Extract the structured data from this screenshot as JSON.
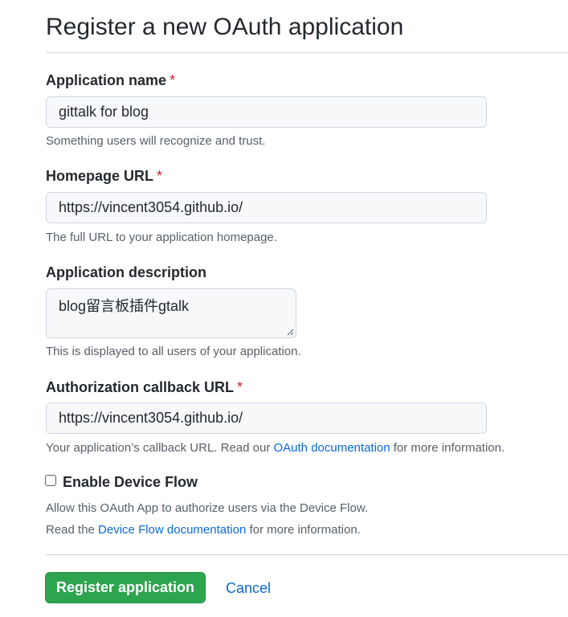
{
  "page": {
    "title": "Register a new OAuth application"
  },
  "form": {
    "app_name": {
      "label": "Application name",
      "required_mark": "*",
      "value": "gittalk for blog",
      "hint": "Something users will recognize and trust."
    },
    "homepage_url": {
      "label": "Homepage URL",
      "required_mark": "*",
      "value": "https://vincent3054.github.io/",
      "hint": "The full URL to your application homepage."
    },
    "description": {
      "label": "Application description",
      "value": "blog留言板插件gtalk",
      "hint": "This is displayed to all users of your application."
    },
    "callback_url": {
      "label": "Authorization callback URL",
      "required_mark": "*",
      "value": "https://vincent3054.github.io/",
      "hint_before": "Your application’s callback URL. Read our ",
      "hint_link": "OAuth documentation",
      "hint_after": " for more information."
    },
    "device_flow": {
      "label": "Enable Device Flow",
      "checked": false,
      "hint_line1": "Allow this OAuth App to authorize users via the Device Flow.",
      "hint_line2_before": "Read the ",
      "hint_line2_link": "Device Flow documentation",
      "hint_line2_after": " for more information."
    }
  },
  "actions": {
    "register_label": "Register application",
    "cancel_label": "Cancel"
  },
  "colors": {
    "primary_button": "#2da44e",
    "link": "#0969da",
    "required": "#cf222e"
  }
}
